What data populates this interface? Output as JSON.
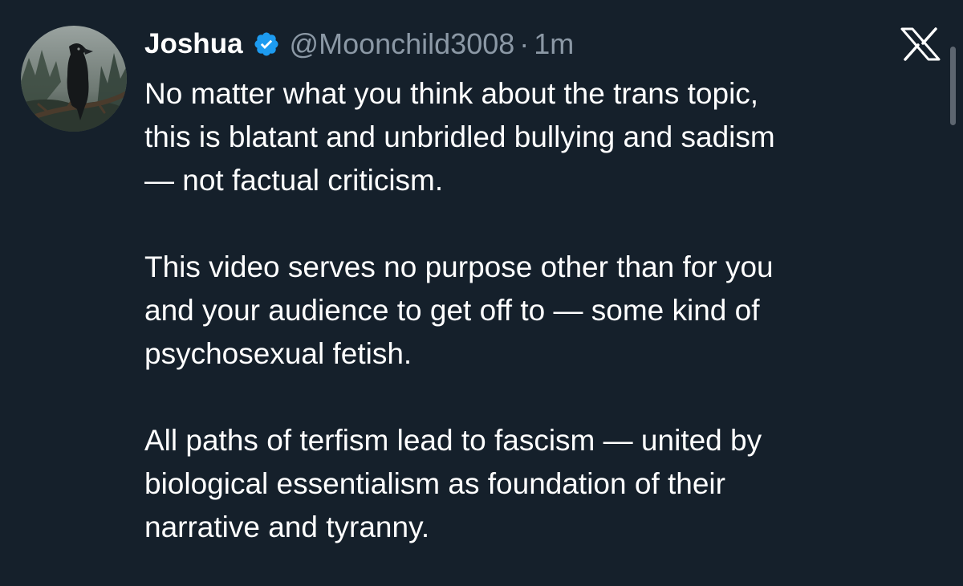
{
  "tweet": {
    "author_name": "Joshua",
    "handle": "@Moonchild3008",
    "separator": "·",
    "timestamp": "1m",
    "verified": true,
    "avatar_icon": "raven-on-branch-avatar",
    "platform_logo": "x-logo-icon",
    "paragraphs": [
      {
        "lines": [
          "No matter what you think about the trans topic,",
          "this is blatant and unbridled bullying and sadism",
          "— not factual criticism."
        ]
      },
      {
        "lines": [
          "This video serves no purpose other than for you",
          "and your audience to get off to — some kind of",
          "psychosexual fetish."
        ]
      },
      {
        "lines": [
          "All paths of terfism lead to fascism — united by",
          "biological essentialism as foundation of their",
          "narrative and tyranny."
        ]
      }
    ]
  },
  "colors": {
    "background": "#15202b",
    "text_primary": "#ffffff",
    "text_secondary": "#8b98a5",
    "verified_badge": "#1d9bf0"
  }
}
